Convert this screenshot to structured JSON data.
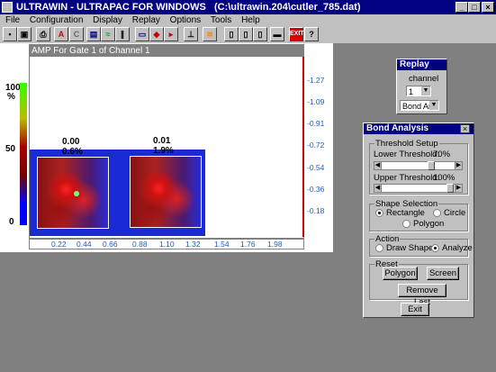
{
  "app": {
    "title": "ULTRAWIN - ULTRAPAC FOR WINDOWS",
    "file_path": "(C:\\ultrawin.204\\cutler_785.dat)",
    "title_buttons": [
      "_",
      "□",
      "×"
    ]
  },
  "menu": [
    "File",
    "Configuration",
    "Display",
    "Replay",
    "Options",
    "Tools",
    "Help"
  ],
  "toolbar": {
    "items": [
      "save-icon",
      "open-icon",
      "print-icon",
      "A",
      "C",
      "scan-icon",
      "wave-icon",
      "probe-icon",
      "monitor-icon",
      "record-icon",
      "play-icon",
      "gate-icon",
      "rainbow-icon",
      "sensor1-icon",
      "sensor2-icon",
      "sensor3-icon",
      "cassette-icon",
      "EXIT",
      "help-icon"
    ]
  },
  "plot": {
    "header": "AMP For Gate 1 of Channel 1",
    "scale": {
      "top": "100",
      "unit": "%",
      "mid": "50",
      "bottom": "0"
    },
    "right_ticks": [
      "-1.27",
      "-1.09",
      "-0.91",
      "-0.72",
      "-0.54",
      "-0.36",
      "-0.18"
    ],
    "bottom_ticks": [
      "0.22",
      "0.44",
      "0.66",
      "0.88",
      "1.10",
      "1.32",
      "1.54",
      "1.76",
      "1.98"
    ],
    "shape1": {
      "value": "0.00",
      "pct": "0.6%"
    },
    "shape2": {
      "value": "0.01",
      "pct": "1.9%"
    },
    "colors": {
      "scale_top": "#33ff00",
      "scale_mid": "#aa0000",
      "scale_bottom": "#0000ff",
      "background": "#1a2bd6"
    }
  },
  "replay": {
    "title": "Replay",
    "channel_label": "channel",
    "channel_value": "1",
    "mode_value": "Bond An"
  },
  "bond": {
    "title": "Bond Analysis",
    "threshold_setup": "Threshold Setup",
    "lower_label": "Lower Threshold:",
    "lower_value": "70%",
    "lower_level": 0.7,
    "upper_label": "Upper Threshold:",
    "upper_value": "100%",
    "upper_level": 1.0,
    "shape_selection": "Shape Selection",
    "rect_label": "Rectangle",
    "circle_label": "Circle",
    "polygon_label": "Polygon",
    "action": "Action",
    "draw_label": "Draw Shape",
    "analyze_label": "Analyze",
    "reset": "Reset",
    "polygon_btn": "Polygon",
    "screen_btn": "Screen",
    "remove_last_btn": "Remove Last",
    "exit_btn": "Exit"
  }
}
